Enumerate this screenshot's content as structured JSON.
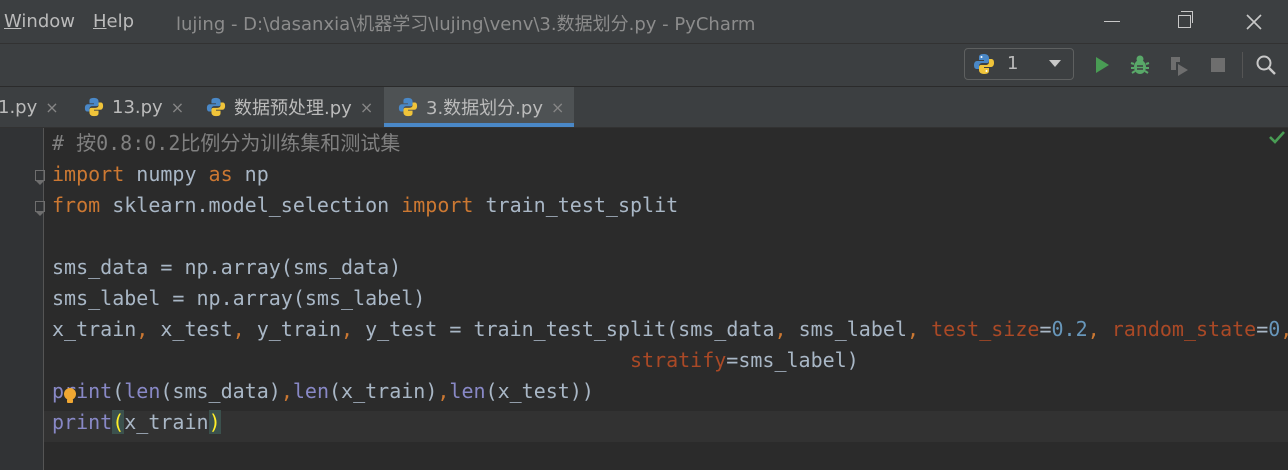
{
  "menu": {
    "window": "Window",
    "window_mnemonic": "W",
    "window_rest": "indow",
    "help": "Help",
    "help_mnemonic": "H",
    "help_rest": "elp"
  },
  "window_title": "lujing - D:\\dasanxia\\机器学习\\lujing\\venv\\3.数据划分.py - PyCharm",
  "toolbar": {
    "run_config_label": "1",
    "icons": [
      "python-icon",
      "run-icon",
      "debug-icon",
      "coverage-icon",
      "stop-icon",
      "search-icon"
    ],
    "colors": {
      "run": "#499c54",
      "debug": "#59a869",
      "disabled": "#6e6e6e"
    }
  },
  "tabs": [
    {
      "label": "1.py",
      "active": false
    },
    {
      "label": "13.py",
      "active": false
    },
    {
      "label": "数据预处理.py",
      "active": false
    },
    {
      "label": "3.数据划分.py",
      "active": true
    }
  ],
  "tab_close_glyph": "×",
  "editor": {
    "lines": [
      [
        {
          "t": "# 按0.8:0.2比例分为训练集和测试集",
          "c": "cm"
        }
      ],
      [
        {
          "t": "import",
          "c": "kw"
        },
        {
          "t": " numpy "
        },
        {
          "t": "as",
          "c": "kw"
        },
        {
          "t": " np"
        }
      ],
      [
        {
          "t": "from",
          "c": "kw"
        },
        {
          "t": " sklearn.model_selection "
        },
        {
          "t": "import",
          "c": "kw"
        },
        {
          "t": " train_test_split"
        }
      ],
      [],
      [
        {
          "t": "sms_data = np.array(sms_data)"
        }
      ],
      [
        {
          "t": "sms_label = np.array(sms_label)"
        }
      ],
      [
        {
          "t": "x_train"
        },
        {
          "t": ",",
          "c": "kw"
        },
        {
          "t": " x_test"
        },
        {
          "t": ",",
          "c": "kw"
        },
        {
          "t": " y_train"
        },
        {
          "t": ",",
          "c": "kw"
        },
        {
          "t": " y_test = train_test_split(sms_data"
        },
        {
          "t": ",",
          "c": "kw"
        },
        {
          "t": " sms_label"
        },
        {
          "t": ",",
          "c": "kw"
        },
        {
          "t": " "
        },
        {
          "t": "test_size",
          "c": "param"
        },
        {
          "t": "="
        },
        {
          "t": "0.2",
          "c": "num"
        },
        {
          "t": ",",
          "c": "kw"
        },
        {
          "t": " "
        },
        {
          "t": "random_state",
          "c": "param"
        },
        {
          "t": "="
        },
        {
          "t": "0",
          "c": "num"
        },
        {
          "t": ",",
          "c": "kw"
        }
      ],
      [
        {
          "t": "                                                "
        },
        {
          "t": "stratify",
          "c": "param"
        },
        {
          "t": "=sms_label)"
        }
      ],
      [
        {
          "t": "print",
          "c": "fn"
        },
        {
          "t": "("
        },
        {
          "t": "len",
          "c": "fn"
        },
        {
          "t": "(sms_data)"
        },
        {
          "t": ",",
          "c": "kw"
        },
        {
          "t": "len",
          "c": "fn"
        },
        {
          "t": "(x_train)"
        },
        {
          "t": ",",
          "c": "kw"
        },
        {
          "t": "len",
          "c": "fn"
        },
        {
          "t": "(x_test))"
        }
      ],
      [
        {
          "t": "print",
          "c": "fn"
        },
        {
          "t": "(",
          "c": "brace-hl"
        },
        {
          "t": "x_train"
        },
        {
          "t": ")",
          "c": "brace-hl"
        }
      ]
    ],
    "colors": {
      "keyword": "#cc7832",
      "comment": "#808080",
      "number": "#6897bb",
      "param": "#aa4926",
      "builtin": "#8888c6",
      "brace_match": "#ffef28",
      "inspection_ok": "#499c54",
      "bulb": "#f0a732"
    }
  }
}
